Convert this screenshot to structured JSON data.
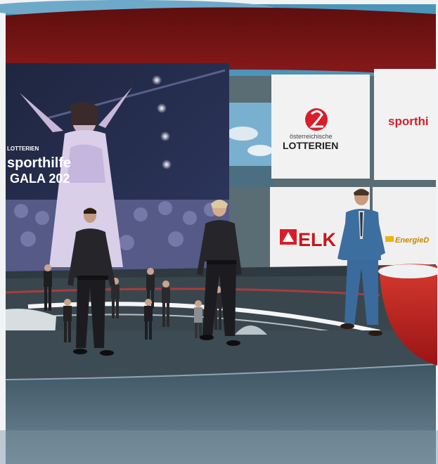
{
  "screen": {
    "line1": "LOTTERIEN",
    "line2": "sporthilfe",
    "line3": "GALA 202"
  },
  "sponsors": {
    "lotterien_top": "österreichische",
    "lotterien_main": "LOTTERIEN",
    "sporthilfe": "sporthi",
    "elk": "ELK",
    "energie": "EnergieD"
  },
  "colors": {
    "sky": "#3a8ab3",
    "ceiling": "#7a1414",
    "floor": "#4f6878",
    "podium": "#c62222",
    "brand_red": "#d81e2a"
  },
  "avatars": {
    "count_foreground": 3,
    "count_background": 12
  }
}
